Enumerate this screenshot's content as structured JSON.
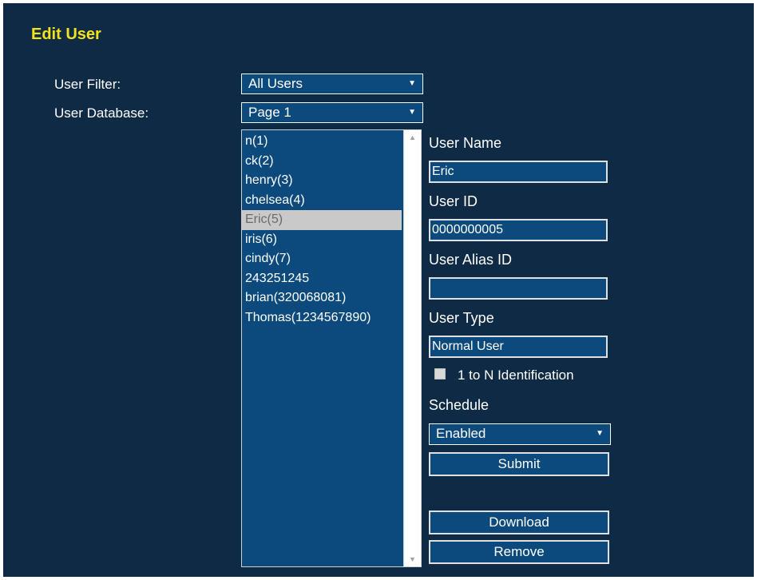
{
  "page": {
    "title": "Edit User"
  },
  "filters": {
    "user_filter_label": "User Filter:",
    "user_filter_value": "All Users",
    "user_database_label": "User Database:",
    "user_database_value": "Page 1"
  },
  "user_list": {
    "items": [
      "n(1)",
      "ck(2)",
      "henry(3)",
      "chelsea(4)",
      "Eric(5)",
      "iris(6)",
      "cindy(7)",
      "243251245",
      "brian(320068081)",
      "Thomas(1234567890)"
    ],
    "selected_index": 4
  },
  "form": {
    "user_name_label": "User Name",
    "user_name_value": "Eric",
    "user_id_label": "User ID",
    "user_id_value": "0000000005",
    "user_alias_label": "User Alias ID",
    "user_alias_value": "",
    "user_type_label": "User Type",
    "user_type_value": "Normal User",
    "identification_label": "1 to N Identification",
    "identification_checked": false,
    "schedule_label": "Schedule",
    "schedule_value": "Enabled",
    "submit_label": "Submit",
    "download_label": "Download",
    "remove_label": "Remove"
  },
  "colors": {
    "background": "#0f2a44",
    "control": "#0c4a7d",
    "title": "#f2e21b",
    "selection": "#c9c9c9"
  },
  "icons": {
    "dropdown": "triangle-down-icon",
    "scroll_up": "triangle-up-icon",
    "scroll_down": "triangle-down-icon"
  }
}
